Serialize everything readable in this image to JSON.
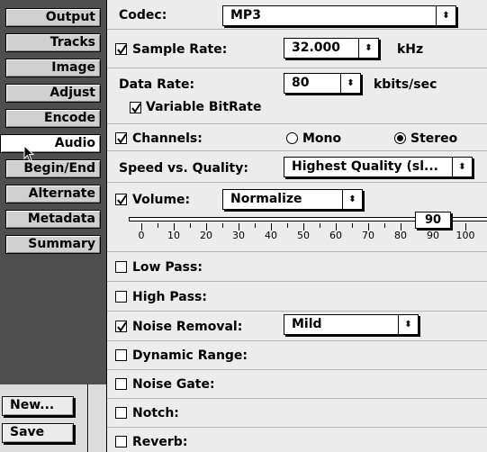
{
  "sidebar": {
    "tabs": [
      "Output",
      "Tracks",
      "Image",
      "Adjust",
      "Encode",
      "Audio",
      "Begin/End",
      "Alternate",
      "Metadata",
      "Summary"
    ],
    "active_tab": "Audio",
    "buttons": [
      "New...",
      "Save"
    ]
  },
  "audio": {
    "codec_label": "Codec:",
    "codec_value": "MP3",
    "sample_rate_label": "Sample Rate:",
    "sample_rate_value": "32.000",
    "sample_rate_unit": "kHz",
    "data_rate_label": "Data Rate:",
    "data_rate_value": "80",
    "data_rate_unit": "kbits/sec",
    "vbr_label": "Variable BitRate",
    "channels_label": "Channels:",
    "mono_label": "Mono",
    "stereo_label": "Stereo",
    "channels_selected": "Stereo",
    "speed_label": "Speed vs. Quality:",
    "speed_value": "Highest Quality (sl...",
    "volume_label": "Volume:",
    "volume_mode": "Normalize",
    "volume_value": "90",
    "scale_labels": [
      "0",
      "10",
      "20",
      "30",
      "40",
      "50",
      "60",
      "70",
      "80",
      "90",
      "100"
    ],
    "low_pass_label": "Low Pass:",
    "high_pass_label": "High Pass:",
    "noise_removal_label": "Noise Removal:",
    "noise_removal_value": "Mild",
    "dynamic_range_label": "Dynamic Range:",
    "noise_gate_label": "Noise Gate:",
    "notch_label": "Notch:",
    "reverb_label": "Reverb:"
  }
}
